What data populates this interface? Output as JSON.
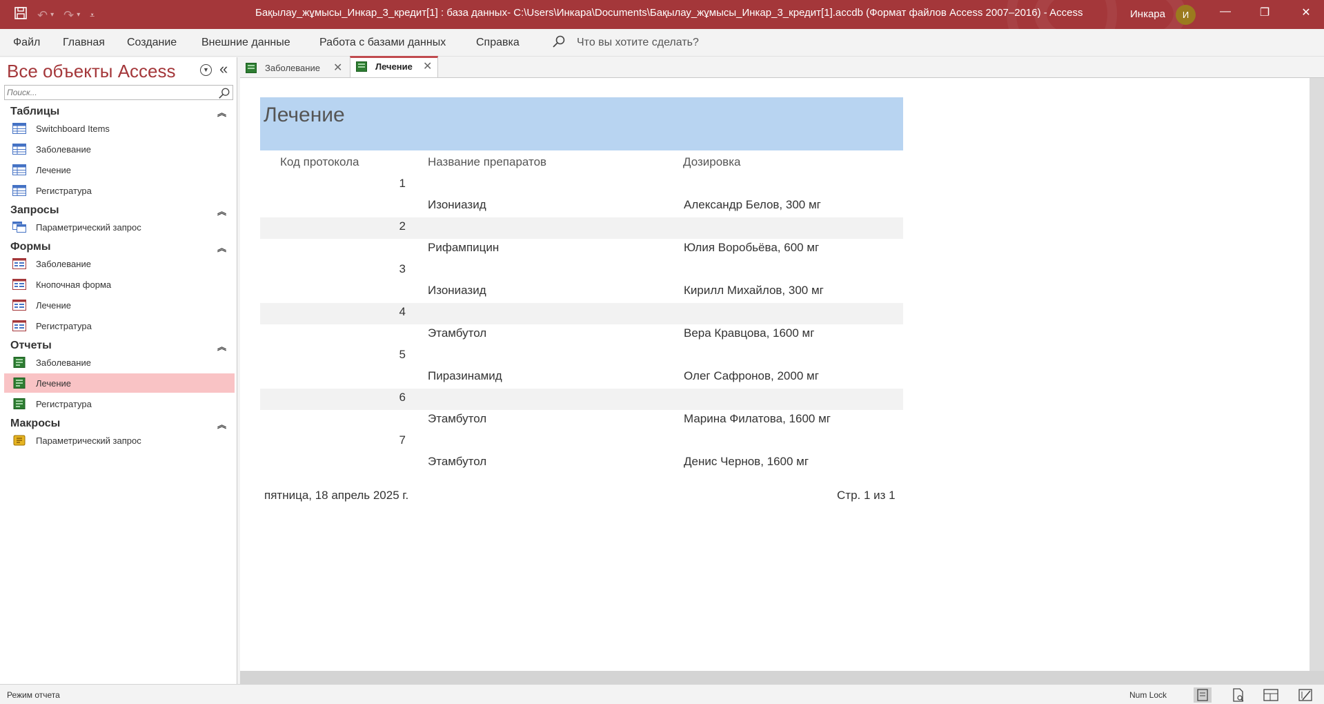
{
  "window": {
    "title": "Бақылау_жұмысы_Инкар_3_кредит[1] : база данных- C:\\Users\\Инкара\\Documents\\Бақылау_жұмысы_Инкар_3_кредит[1].accdb (Формат файлов Access 2007–2016)  -  Access",
    "user_name": "Инкара",
    "avatar_initial": "И"
  },
  "ribbon": {
    "tabs": [
      "Файл",
      "Главная",
      "Создание",
      "Внешние данные",
      "Работа с базами данных",
      "Справка"
    ],
    "tell_me": "Что вы хотите сделать?"
  },
  "nav": {
    "title": "Все объекты Access",
    "search_placeholder": "Поиск...",
    "groups": [
      {
        "label": "Таблицы",
        "items": [
          "Switchboard Items",
          "Заболевание",
          "Лечение",
          "Регистратура"
        ]
      },
      {
        "label": "Запросы",
        "items": [
          "Параметрический запрос"
        ]
      },
      {
        "label": "Формы",
        "items": [
          "Заболевание",
          "Кнопочная форма",
          "Лечение",
          "Регистратура"
        ]
      },
      {
        "label": "Отчеты",
        "items": [
          "Заболевание",
          "Лечение",
          "Регистратура"
        ]
      },
      {
        "label": "Макросы",
        "items": [
          "Параметрический запрос"
        ]
      }
    ]
  },
  "doc_tabs": [
    {
      "label": "Заболевание",
      "active": false
    },
    {
      "label": "Лечение",
      "active": true
    }
  ],
  "report": {
    "title": "Лечение",
    "columns": [
      "Код протокола",
      "Название препаратов",
      "Дозировка"
    ],
    "rows": [
      {
        "code": "1",
        "drug": "Изониазид",
        "dose": "Александр Белов, 300 мг"
      },
      {
        "code": "2",
        "drug": "Рифампицин",
        "dose": "Юлия Воробьёва, 600 мг"
      },
      {
        "code": "3",
        "drug": "Изониазид",
        "dose": "Кирилл Михайлов, 300 мг"
      },
      {
        "code": "4",
        "drug": "Этамбутол",
        "dose": "Вера Кравцова, 1600 мг"
      },
      {
        "code": "5",
        "drug": "Пиразинамид",
        "dose": "Олег Сафронов, 2000 мг"
      },
      {
        "code": "6",
        "drug": "Этамбутол",
        "dose": "Марина Филатова, 1600 мг"
      },
      {
        "code": "7",
        "drug": "Этамбутол",
        "dose": "Денис Чернов, 1600 мг"
      }
    ],
    "footer_date": "пятница, 18 апрель 2025 г.",
    "footer_page": "Стр. 1 из 1"
  },
  "status": {
    "mode": "Режим отчета",
    "numlock": "Num Lock"
  },
  "colors": {
    "accent": "#a4373a",
    "report_header": "#b8d4f1",
    "selected_item": "#f9c3c5"
  }
}
